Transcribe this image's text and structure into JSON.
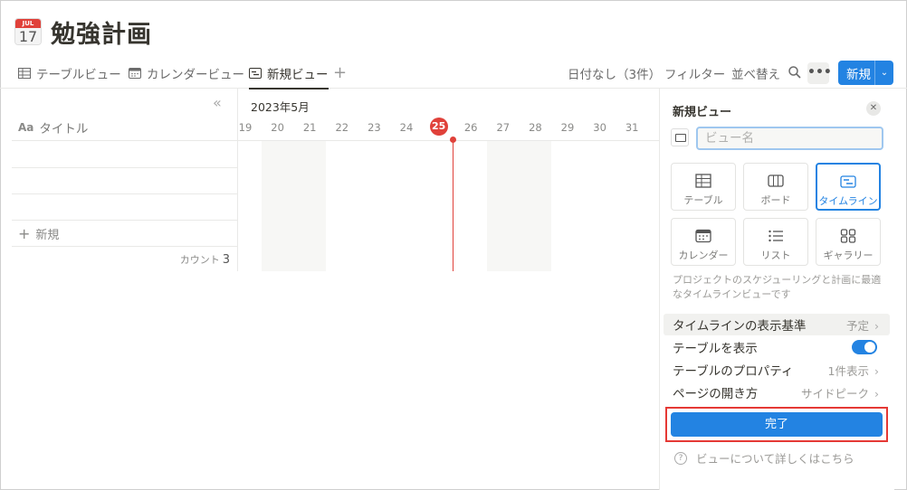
{
  "page": {
    "icon": {
      "name": "calendar-icon",
      "month": "JUL",
      "day": "17"
    },
    "title": "勉強計画"
  },
  "tabs": [
    {
      "label": "テーブルビュー",
      "icon": "table-icon"
    },
    {
      "label": "カレンダービュー",
      "icon": "calendar-icon"
    },
    {
      "label": "新規ビュー",
      "icon": "timeline-icon",
      "active": true
    }
  ],
  "toolbar": {
    "no_date": "日付なし（3件）",
    "filter": "フィルター",
    "sort": "並べ替え",
    "more": "•••",
    "new_label": "新規"
  },
  "table": {
    "title_header_prefix": "Aa",
    "title_header": "タイトル",
    "add_row": "新規",
    "count_label": "カウント",
    "count_value": "3"
  },
  "timeline": {
    "month": "2023年5月",
    "days": [
      "19",
      "20",
      "21",
      "22",
      "23",
      "24",
      "25",
      "26",
      "27",
      "28",
      "29",
      "30",
      "31"
    ],
    "today": "25",
    "today_color": "#e0413a"
  },
  "panel": {
    "title": "新規ビュー",
    "name_placeholder": "ビュー名",
    "layouts": [
      {
        "label": "テーブル",
        "icon": "table-icon"
      },
      {
        "label": "ボード",
        "icon": "board-icon"
      },
      {
        "label": "タイムライン",
        "icon": "timeline-icon",
        "selected": true
      },
      {
        "label": "カレンダー",
        "icon": "calendar-icon"
      },
      {
        "label": "リスト",
        "icon": "list-icon"
      },
      {
        "label": "ギャラリー",
        "icon": "gallery-icon"
      }
    ],
    "description": "プロジェクトのスケジューリングと計画に最適なタイムラインビューです",
    "settings": {
      "show_by_label": "タイムラインの表示基準",
      "show_by_value": "予定",
      "show_table_label": "テーブルを表示",
      "show_table_on": true,
      "table_props_label": "テーブルのプロパティ",
      "table_props_value": "1件表示",
      "open_pages_label": "ページの開き方",
      "open_pages_value": "サイドピーク"
    },
    "done_label": "完了",
    "learn_more": "ビューについて詳しくはこちら"
  },
  "colors": {
    "accent": "#2383e2",
    "highlight_border": "#e53935"
  }
}
